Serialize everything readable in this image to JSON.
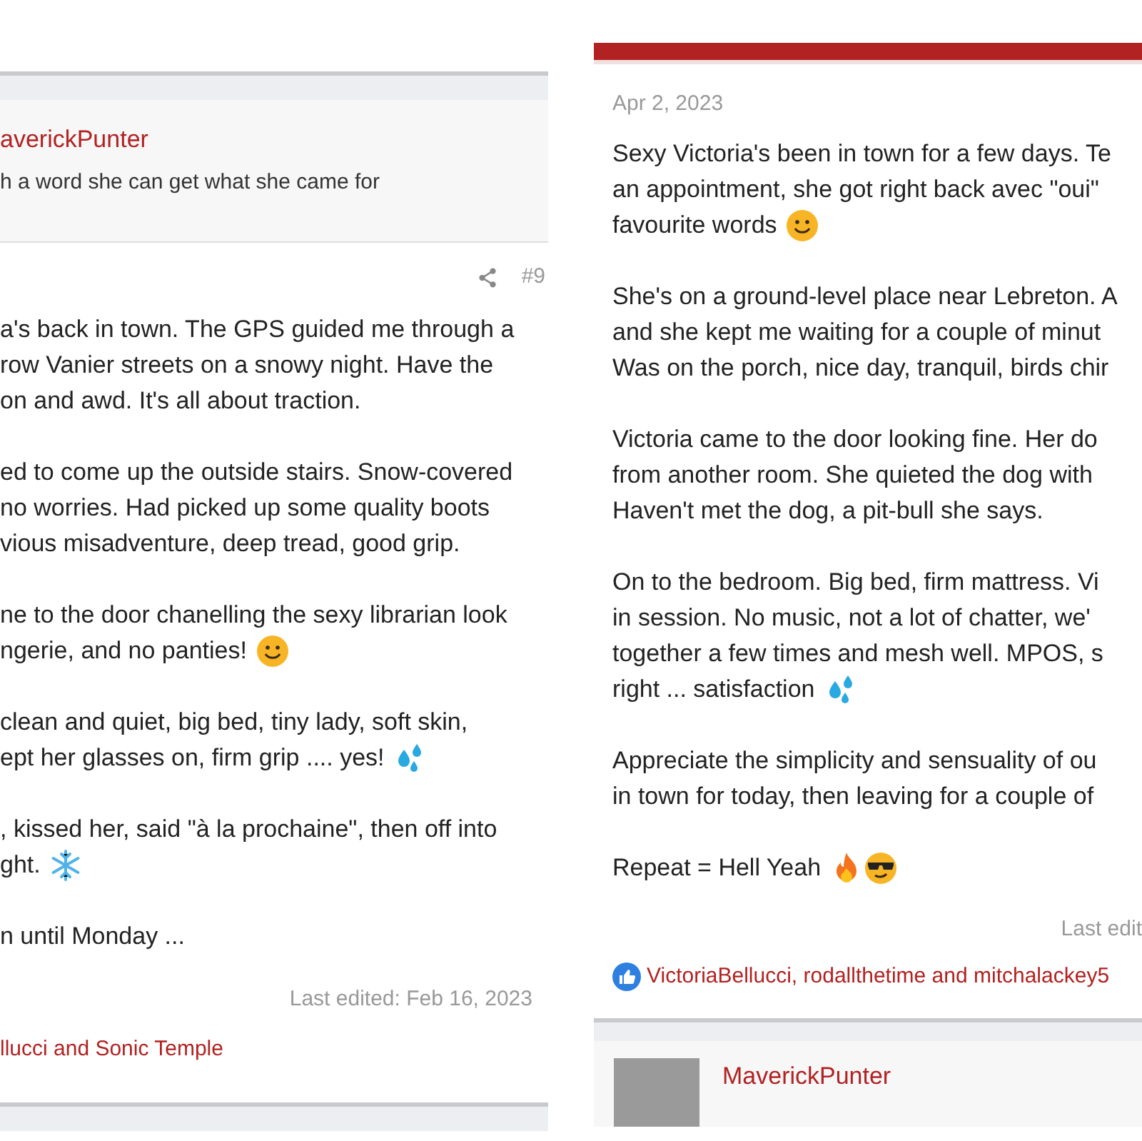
{
  "left_post": {
    "author": "averickPunter",
    "signature": "h a word she can get what she came for",
    "post_number": "#9",
    "paragraphs": [
      {
        "lines": [
          {
            "text": "a's back in town. The GPS guided me through a"
          },
          {
            "text": "row Vanier streets on a snowy night. Have the"
          },
          {
            "text": "on and awd. It's all about traction."
          }
        ]
      },
      {
        "lines": [
          {
            "text": "ed to come up the outside stairs. Snow-covered"
          },
          {
            "text": "no worries. Had picked up some quality boots"
          },
          {
            "text": "vious misadventure, deep tread, good grip."
          }
        ]
      },
      {
        "lines": [
          {
            "text": "ne to the door chanelling the sexy librarian look"
          },
          {
            "text": "ngerie, and no panties!",
            "smiley": true
          }
        ]
      },
      {
        "lines": [
          {
            "text": "clean and quiet, big bed, tiny lady, soft skin,"
          },
          {
            "text": "ept her glasses on, firm grip .... yes!",
            "droplets": true
          }
        ]
      },
      {
        "lines": [
          {
            "text": ", kissed her, said \"à la prochaine\", then off into"
          },
          {
            "text": "ght.",
            "snowflake": true
          }
        ]
      },
      {
        "lines": [
          {
            "text": "n until Monday ..."
          }
        ]
      }
    ],
    "last_edited": "Last edited: Feb 16, 2023",
    "reactions": "llucci and Sonic Temple"
  },
  "right_post": {
    "date": "Apr 2, 2023",
    "paragraphs": [
      {
        "lines": [
          {
            "text": "Sexy Victoria's been in town for a few days. Te"
          },
          {
            "text": "an appointment, she got right back avec \"oui\""
          },
          {
            "text": "favourite words",
            "smiley": true
          }
        ]
      },
      {
        "lines": [
          {
            "text": "She's on a ground-level place near Lebreton. A"
          },
          {
            "text": "and she kept me waiting for a couple of minut"
          },
          {
            "text": "Was on the porch, nice day, tranquil, birds chir"
          }
        ]
      },
      {
        "lines": [
          {
            "text": "Victoria came to the door looking fine. Her do"
          },
          {
            "text": "from another room. She quieted the dog with"
          },
          {
            "text": "Haven't met the dog, a pit-bull she says."
          }
        ]
      },
      {
        "lines": [
          {
            "text": "On to the bedroom. Big bed, firm mattress. Vi"
          },
          {
            "text": "in session. No music, not a lot of chatter, we'"
          },
          {
            "text": "together a few times and mesh well. MPOS, s"
          },
          {
            "text": "right ... satisfaction",
            "droplets": true
          }
        ]
      },
      {
        "lines": [
          {
            "text": "Appreciate the simplicity and sensuality of ou"
          },
          {
            "text": "in town for today, then leaving for a couple of"
          }
        ]
      },
      {
        "lines": [
          {
            "text": "Repeat = Hell Yeah",
            "fire": true,
            "sunglasses": true
          }
        ]
      }
    ],
    "last_edited": "Last edit",
    "reactions": "VictoriaBellucci, rodallthetime and mitchalackey5",
    "next_author": "MaverickPunter"
  }
}
